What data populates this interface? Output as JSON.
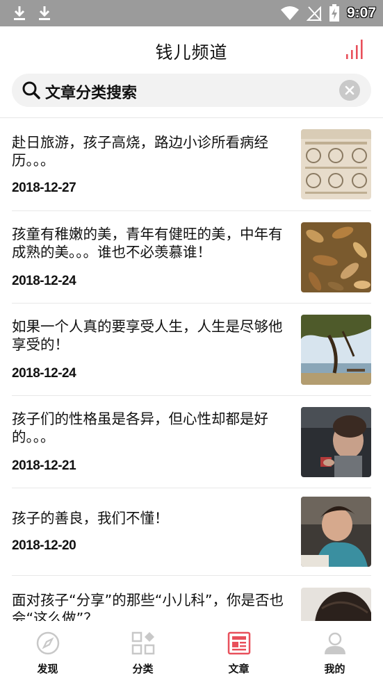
{
  "status_bar": {
    "time": "9:07"
  },
  "header": {
    "title": "钱儿频道"
  },
  "search": {
    "placeholder": "文章分类搜索"
  },
  "articles": [
    {
      "title": "赴日旅游，孩子高烧，路边小诊所看病经历。。。",
      "date": "2018-12-27",
      "thumb": "document-photo"
    },
    {
      "title": "孩童有稚嫩的美，青年有健旺的美，中年有成熟的美。。。谁也不必羡慕谁！",
      "date": "2018-12-24",
      "thumb": "autumn-leaves-photo"
    },
    {
      "title": "如果一个人真的要享受人生，人生是尽够他享受的！",
      "date": "2018-12-24",
      "thumb": "tree-landscape-photo"
    },
    {
      "title": "孩子们的性格虽是各异，但心性却都是好的。。。",
      "date": "2018-12-21",
      "thumb": "child-in-car-photo"
    },
    {
      "title": "孩子的善良，我们不懂！",
      "date": "2018-12-20",
      "thumb": "child-reading-photo"
    },
    {
      "title": "面对孩子“分享”的那些“小儿科”，你是否也会“这么做”？",
      "date": "",
      "thumb": "child-hair-photo"
    }
  ],
  "tabs": [
    {
      "label": "发现",
      "icon": "compass-icon",
      "active": false
    },
    {
      "label": "分类",
      "icon": "grid-icon",
      "active": false
    },
    {
      "label": "文章",
      "icon": "article-icon",
      "active": true
    },
    {
      "label": "我的",
      "icon": "user-icon",
      "active": false
    }
  ],
  "colors": {
    "accent": "#e8505b",
    "inactive": "#c8c8c8",
    "status_bar": "#9b9b9b"
  }
}
